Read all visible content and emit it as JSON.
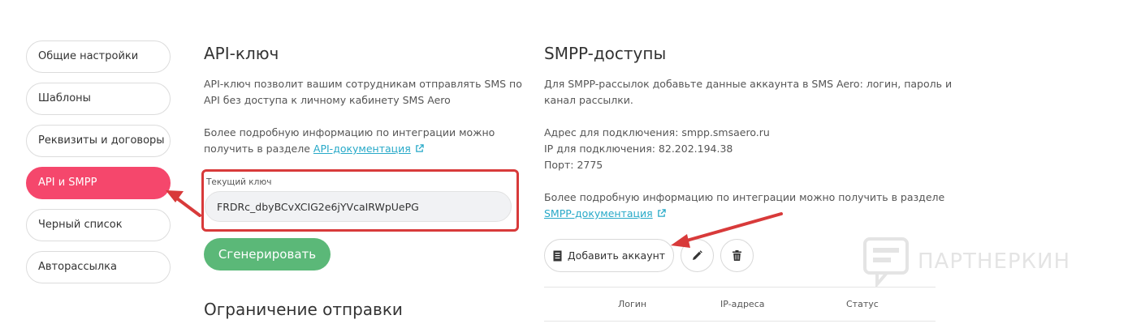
{
  "sidebar": {
    "items": [
      {
        "label": "Общие настройки"
      },
      {
        "label": "Шаблоны"
      },
      {
        "label": "Реквизиты и договоры"
      },
      {
        "label": "API и SMPP"
      },
      {
        "label": "Черный список"
      },
      {
        "label": "Авторассылка"
      }
    ],
    "active_color": "#f5476c"
  },
  "api": {
    "title": "API-ключ",
    "desc_line1": "API-ключ позволит вашим сотрудникам отправлять SMS по",
    "desc_line2": "API без доступа к личному кабинету SMS Aero",
    "info_line1": "Более подробную информацию по интеграции можно",
    "info_prefix": "получить в разделе ",
    "doc_link": "API-документация",
    "key_label": "Текущий ключ",
    "key_value": "FRDRc_dbyBCvXCIG2e6jYVcaIRWpUePG",
    "generate_label": "Сгенерировать",
    "limit_title": "Ограничение отправки"
  },
  "smpp": {
    "title": "SMPP-доступы",
    "desc_line1": "Для SMPP-рассылок добавьте данные аккаунта в SMS Aero: логин, пароль и",
    "desc_line2": "канал рассылки.",
    "address": "Адрес для подключения: smpp.smsaero.ru",
    "ip": "IP для подключения: 82.202.194.38",
    "port": "Порт: 2775",
    "info_line1": "Более подробную информацию по интеграции можно получить в разделе",
    "doc_link": "SMPP-документация",
    "add_account_label": "Добавить аккаунт",
    "table_headers": [
      "Логин",
      "IP-адреса",
      "Статус"
    ]
  },
  "watermark": {
    "text": "ПАРТНЕРКИН"
  },
  "colors": {
    "accent_pink": "#f5476c",
    "green_button": "#5bb878",
    "link": "#27a9c8",
    "annotation_red": "#d83a3a"
  },
  "icons": [
    "external-link-icon",
    "document-icon",
    "pencil-icon",
    "trash-icon",
    "chat-logo-icon"
  ]
}
